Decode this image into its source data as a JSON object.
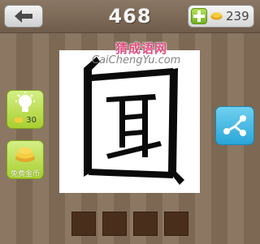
{
  "header": {
    "level_number": "468",
    "coins": "239"
  },
  "watermark": {
    "site_name": "猜成语网",
    "site_url": "CaiChengYu.com"
  },
  "puzzle": {
    "character": "国 with 耳 inside"
  },
  "sidebar": {
    "hint_cost": "30",
    "free_coins_label": "免费金币"
  },
  "answer": {
    "slots": [
      "",
      "",
      "",
      ""
    ]
  },
  "colors": {
    "hint_button": "#b8dc46",
    "share_button": "#3bb5e3",
    "answer_slot": "#4a2e1c",
    "watermark_text": "#e04c7e"
  }
}
